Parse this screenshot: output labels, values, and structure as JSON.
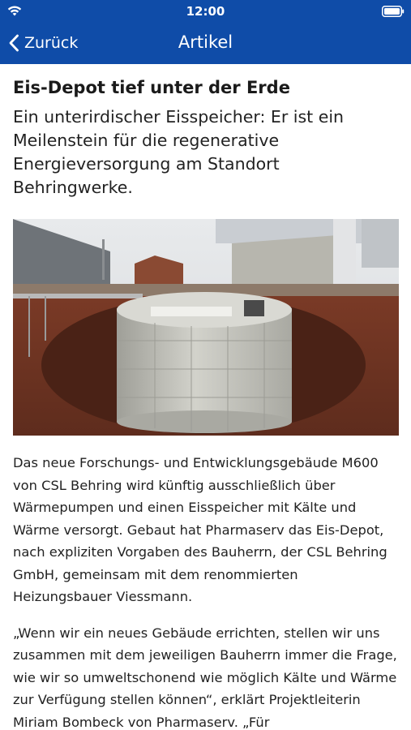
{
  "status_bar": {
    "time": "12:00",
    "icons": [
      "wifi-icon",
      "battery-icon"
    ]
  },
  "nav": {
    "back_label": "Zurück",
    "title": "Artikel",
    "back_icon": "chevron-left-icon"
  },
  "article": {
    "headline": "Eis-Depot tief unter der Erde",
    "subheadline": "Ein unterirdischer Eisspeicher: Er ist ein Meilenstein für die regenerative Energieversorgung am Standort Behringwerke.",
    "paragraphs": [
      "Das neue Forschungs- und Entwicklungsgebäude M600 von CSL Behring wird künftig ausschließlich über Wärmepumpen und einen Eisspeicher mit Kälte und Wärme versorgt. Gebaut hat Pharmaserv das Eis-Depot, nach expliziten Vorgaben des Bauherrn, der CSL Behring GmbH, gemeinsam mit dem renommierten Heizungsbauer Viessmann.",
      "„Wenn wir ein neues Gebäude errichten, stellen wir uns zusammen mit dem jeweiligen Bauherrn immer die Frage, wie wir so umweltschonend wie möglich Kälte und Wärme zur Verfügung stellen können“, erklärt Projektleiterin Miriam Bombeck von Pharmaserv. „Für"
    ]
  },
  "colors": {
    "brand": "#0f4ca8",
    "text": "#222222",
    "background": "#ffffff"
  }
}
